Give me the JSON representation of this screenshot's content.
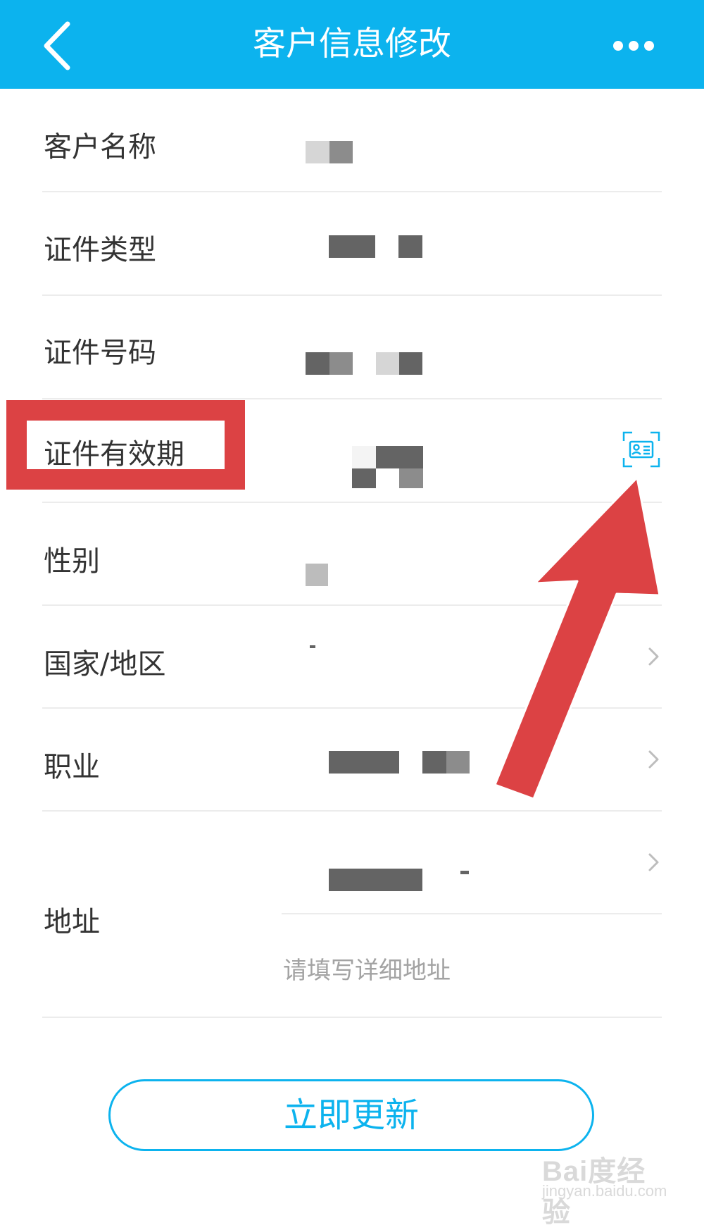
{
  "header": {
    "title": "客户信息修改",
    "back_icon": "chevron-left-icon",
    "more_icon": "more-dots-icon",
    "bg_color": "#0cb3ee"
  },
  "fields": [
    {
      "label": "客户名称"
    },
    {
      "label": "证件类型"
    },
    {
      "label": "证件号码"
    },
    {
      "label": "证件有效期",
      "trailing_icon": "id-card-scan-icon"
    },
    {
      "label": "性别"
    },
    {
      "label": "国家/地区",
      "trailing_icon": "chevron-right-icon"
    },
    {
      "label": "职业",
      "trailing_icon": "chevron-right-icon"
    },
    {
      "label": "地址",
      "trailing_icon": "chevron-right-icon"
    }
  ],
  "address": {
    "placeholder": "请填写详细地址"
  },
  "actions": {
    "update_label": "立即更新"
  },
  "annotation": {
    "highlight_color": "#dc4244"
  },
  "watermark": {
    "logo_text": "Bai度经验",
    "url": "jingyan.baidu.com"
  }
}
